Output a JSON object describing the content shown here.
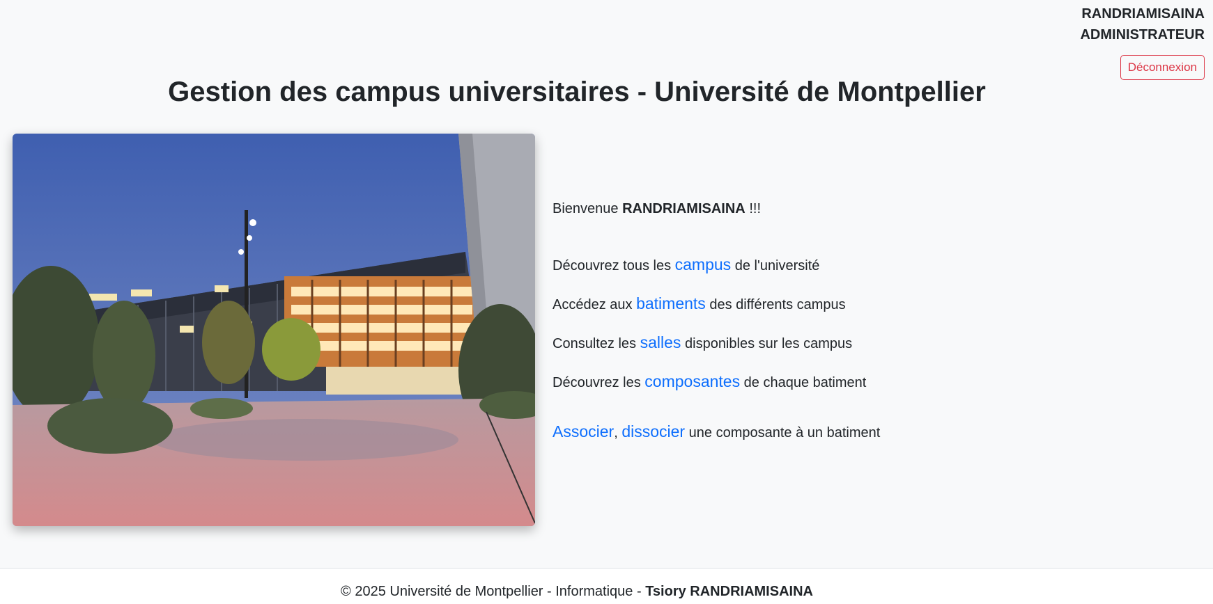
{
  "header": {
    "user_name": "RANDRIAMISAINA",
    "user_role": "ADMINISTRATEUR",
    "logout_label": "Déconnexion",
    "page_title": "Gestion des campus universitaires - Université de Montpellier"
  },
  "welcome": {
    "prefix": "Bienvenue",
    "name": "RANDRIAMISAINA",
    "suffix": "!!!"
  },
  "links": {
    "campus": {
      "before": "Découvrez tous les",
      "link": "campus",
      "after": "de l'université"
    },
    "batiments": {
      "before": "Accédez aux",
      "link": "batiments",
      "after": "des différents campus"
    },
    "salles": {
      "before": "Consultez les",
      "link": "salles",
      "after": "disponibles sur les campus"
    },
    "composantes": {
      "before": "Découvrez les",
      "link": "composantes",
      "after": "de chaque batiment"
    },
    "associer": {
      "link1": "Associer",
      "sep": ",",
      "link2": "dissocier",
      "after": "une composante à un batiment"
    }
  },
  "footer": {
    "text": "© 2025 Université de Montpellier - Informatique -",
    "author": "Tsiory RANDRIAMISAINA"
  },
  "colors": {
    "link": "#0d6efd",
    "logout": "#dc3545",
    "background": "#f8f9fa"
  }
}
